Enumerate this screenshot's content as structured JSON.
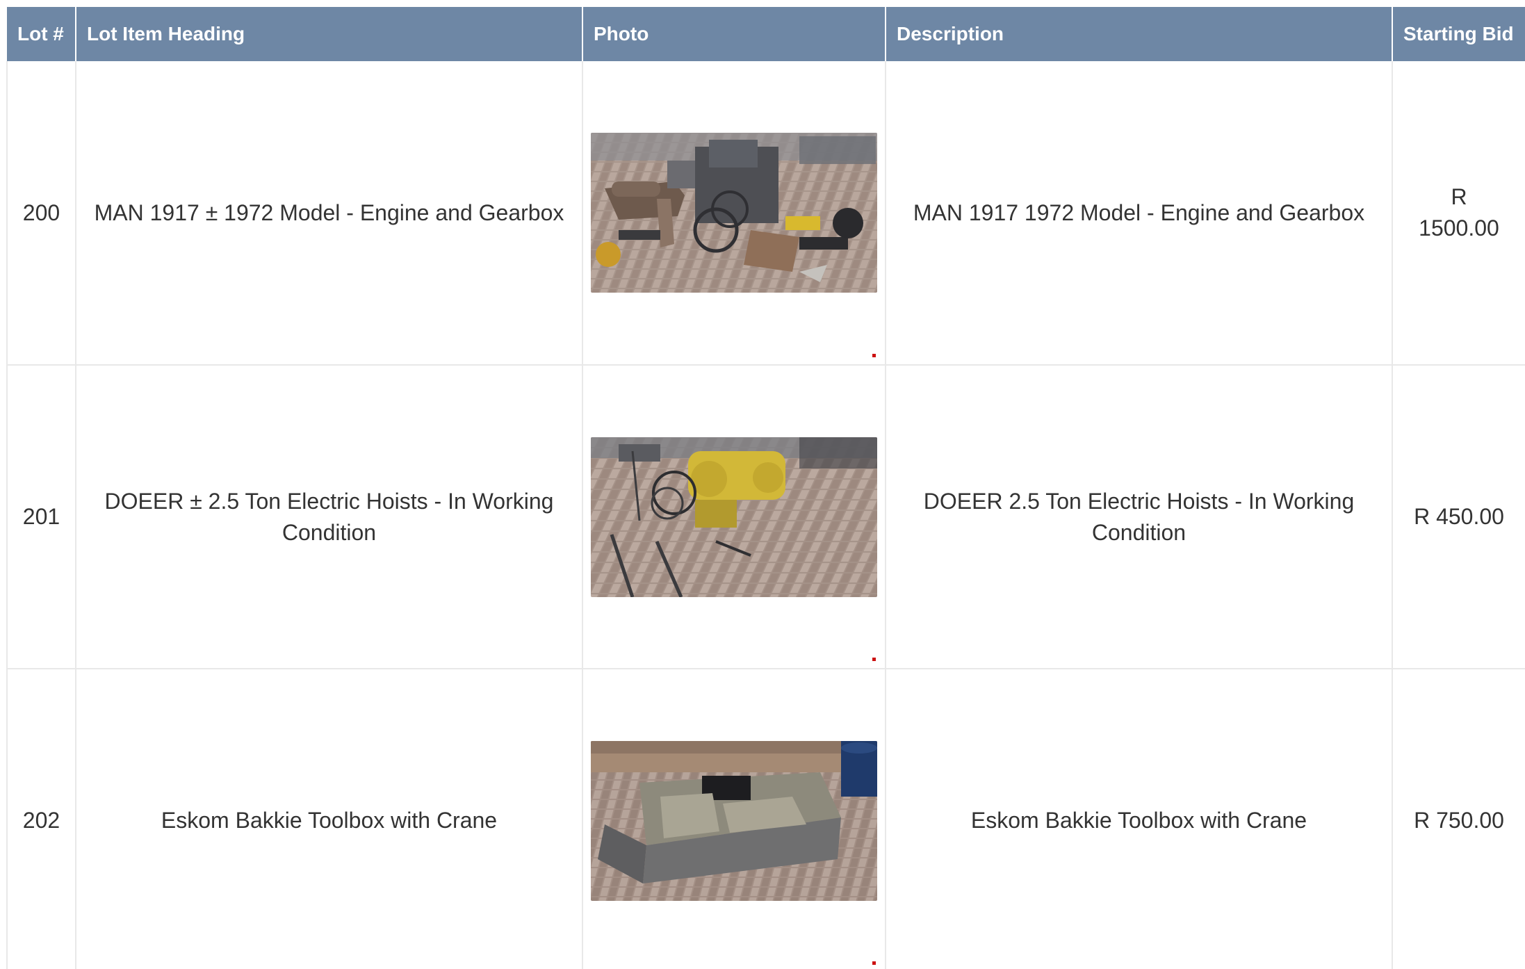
{
  "table": {
    "headers": {
      "lot": "Lot #",
      "heading": "Lot Item Heading",
      "photo": "Photo",
      "description": "Description",
      "bid": "Starting Bid"
    },
    "rows": [
      {
        "lot": "200",
        "heading": "MAN 1917 ± 1972 Model - Engine and Gearbox",
        "photo_alt": "engine-and-gearbox-photo",
        "description": "MAN 1917 1972 Model - Engine and Gearbox",
        "bid": "R 1500.00"
      },
      {
        "lot": "201",
        "heading": "DOEER ± 2.5 Ton Electric Hoists - In Working Condition",
        "photo_alt": "electric-hoists-photo",
        "description": "DOEER 2.5 Ton Electric Hoists - In Working Condition",
        "bid": "R 450.00"
      },
      {
        "lot": "202",
        "heading": "Eskom Bakkie Toolbox with Crane",
        "photo_alt": "toolbox-with-crane-photo",
        "description": "Eskom Bakkie Toolbox with Crane",
        "bid": "R 750.00"
      }
    ]
  },
  "colors": {
    "header_bg": "#6e87a5",
    "header_text": "#ffffff",
    "cell_text": "#333333",
    "grid_line": "#e8e8e8",
    "marker_red": "#cc1111"
  }
}
